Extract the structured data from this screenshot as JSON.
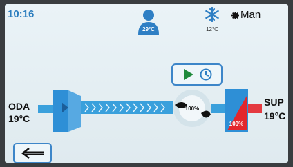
{
  "status": {
    "time": "10:16",
    "mode": "Man"
  },
  "room": {
    "temperature": "29°C",
    "icon": "person-icon"
  },
  "cooling": {
    "temperature": "12°C",
    "icon": "snowflake-icon"
  },
  "controls": {
    "play_icon": "play-icon",
    "schedule_icon": "schedule-icon",
    "back_icon": "back-arrow-icon"
  },
  "oda": {
    "label": "ODA",
    "temperature": "19°C"
  },
  "sup": {
    "label": "SUP",
    "temperature": "19°C"
  },
  "fan": {
    "speed": "100%"
  },
  "valve": {
    "opening": "100%"
  },
  "colors": {
    "accent": "#3d86c9",
    "duct": "#3aa0dc",
    "heater": "#e3262d",
    "text": "#111111"
  }
}
